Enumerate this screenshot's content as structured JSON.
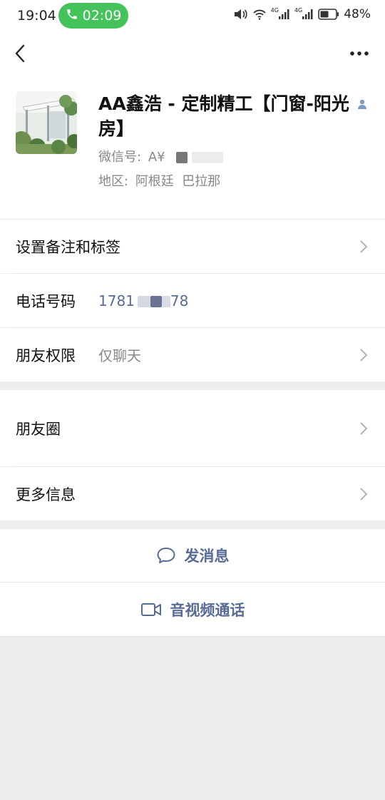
{
  "status_bar": {
    "time": "19:04",
    "call_timer": "02:09",
    "network_1": "4G",
    "network_2": "4G",
    "battery": "48%"
  },
  "profile": {
    "name": "AA鑫浩 - 定制精工【门窗-阳光房】",
    "wechat_id_label": "微信号:",
    "wechat_id_value": "A¥",
    "region_label": "地区:",
    "region_value": "阿根廷  巴拉那"
  },
  "rows": {
    "remark_tags": "设置备注和标签",
    "phone_label": "电话号码",
    "phone_value": "1781",
    "phone_value_tail": "78",
    "permission_label": "朋友权限",
    "permission_value": "仅聊天",
    "moments": "朋友圈",
    "more_info": "更多信息"
  },
  "actions": {
    "send_message": "发消息",
    "video_call": "音视频通话"
  },
  "colors": {
    "call_green": "#43c35a",
    "link_blue": "#576b95",
    "background": "#ededed"
  }
}
